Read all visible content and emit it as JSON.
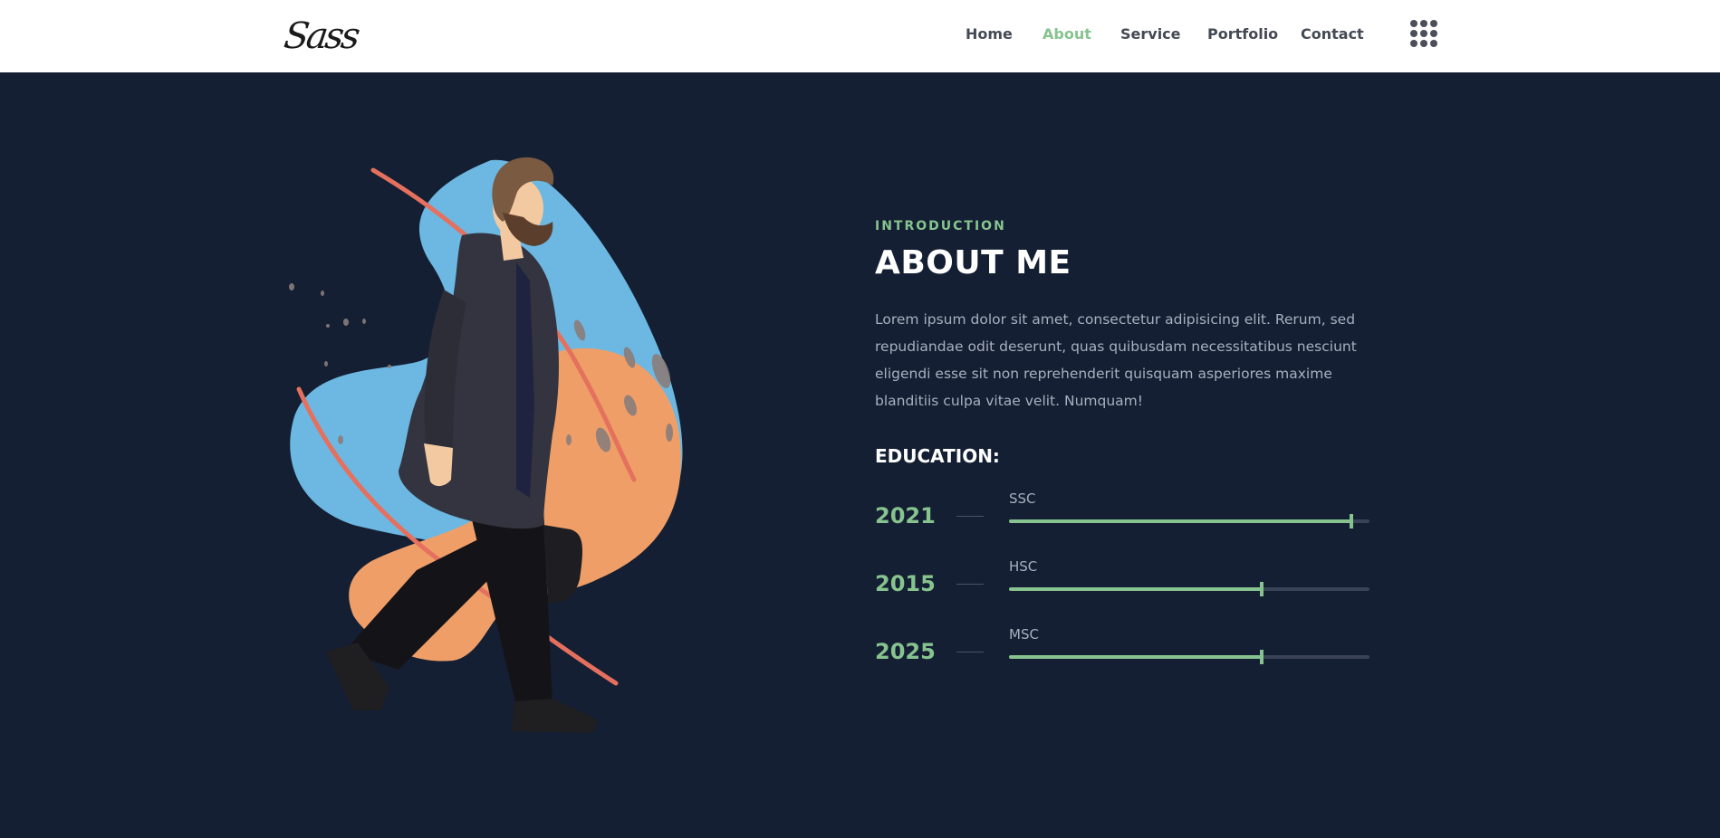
{
  "header": {
    "logo_text": "Sass",
    "nav": [
      {
        "label": "Home",
        "active": false
      },
      {
        "label": "About",
        "active": true
      },
      {
        "label": "Service",
        "active": false
      },
      {
        "label": "Portfolio",
        "active": false
      },
      {
        "label": "Contact",
        "active": false
      }
    ],
    "menu_icon": "grid-icon"
  },
  "about": {
    "eyebrow": "INTRODUCTION",
    "title": "ABOUT ME",
    "paragraph": "Lorem ipsum dolor sit amet, consectetur adipisicing elit. Rerum, sed repudiandae odit deserunt, quas quibusdam necessitatibus nesciunt eligendi esse sit non reprehenderit quisquam asperiores maxime blanditiis culpa vitae velit. Numquam!",
    "education_title": "EDUCATION:",
    "education": [
      {
        "year": "2021",
        "label": "SSC",
        "progress": 0.95
      },
      {
        "year": "2015",
        "label": "HSC",
        "progress": 0.7
      },
      {
        "year": "2025",
        "label": "MSC",
        "progress": 0.7
      }
    ]
  },
  "colors": {
    "background": "#141f33",
    "accent": "#86c38e",
    "blob_blue": "#6cb8e2",
    "blob_orange": "#ef9e68",
    "stripe": "#e5705e"
  }
}
